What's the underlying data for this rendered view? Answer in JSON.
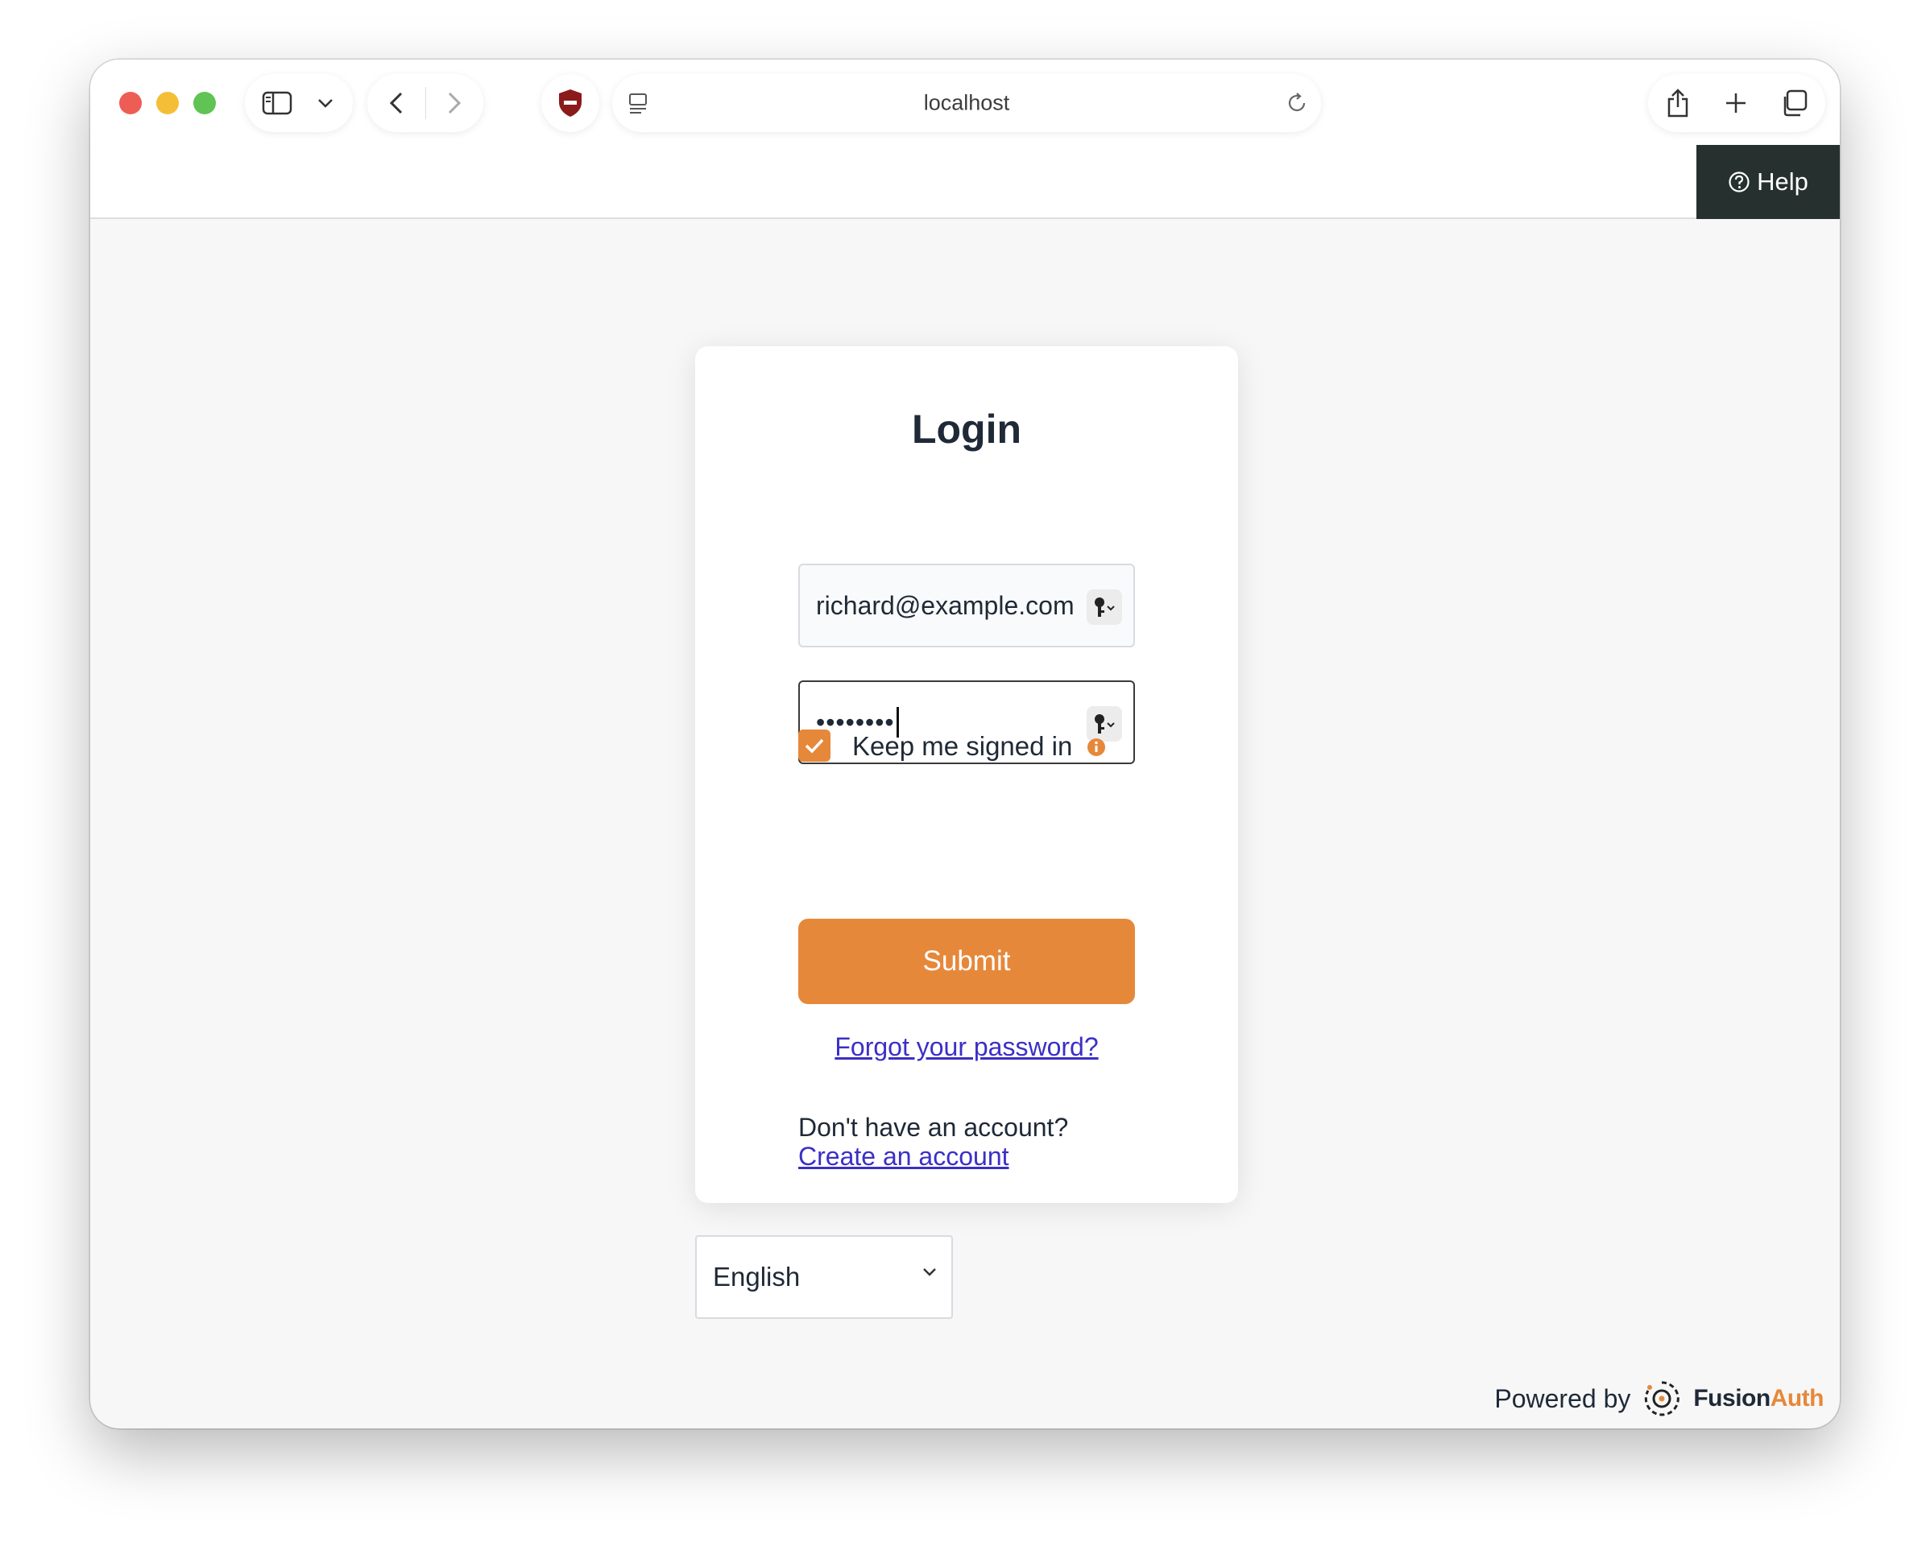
{
  "browser": {
    "url": "localhost",
    "traffic_colors": {
      "close": "#ee5c56",
      "minimize": "#f4bf36",
      "maximize": "#5fc454"
    }
  },
  "header": {
    "help_label": "Help"
  },
  "login": {
    "title": "Login",
    "email_value": "richard@example.com",
    "password_dots": "••••••••",
    "keep_signed_in_label": "Keep me signed in",
    "keep_signed_in_checked": true,
    "submit_label": "Submit",
    "forgot_label": "Forgot your password?",
    "no_account_text": "Don't have an account?",
    "create_account_label": "Create an account"
  },
  "language": {
    "selected": "English"
  },
  "footer": {
    "powered_by": "Powered by",
    "brand_primary": "Fusion",
    "brand_accent": "Auth"
  },
  "colors": {
    "accent": "#e6883a",
    "link": "#3b2fc6",
    "help_bg": "#26302f",
    "text": "#1f2937"
  }
}
